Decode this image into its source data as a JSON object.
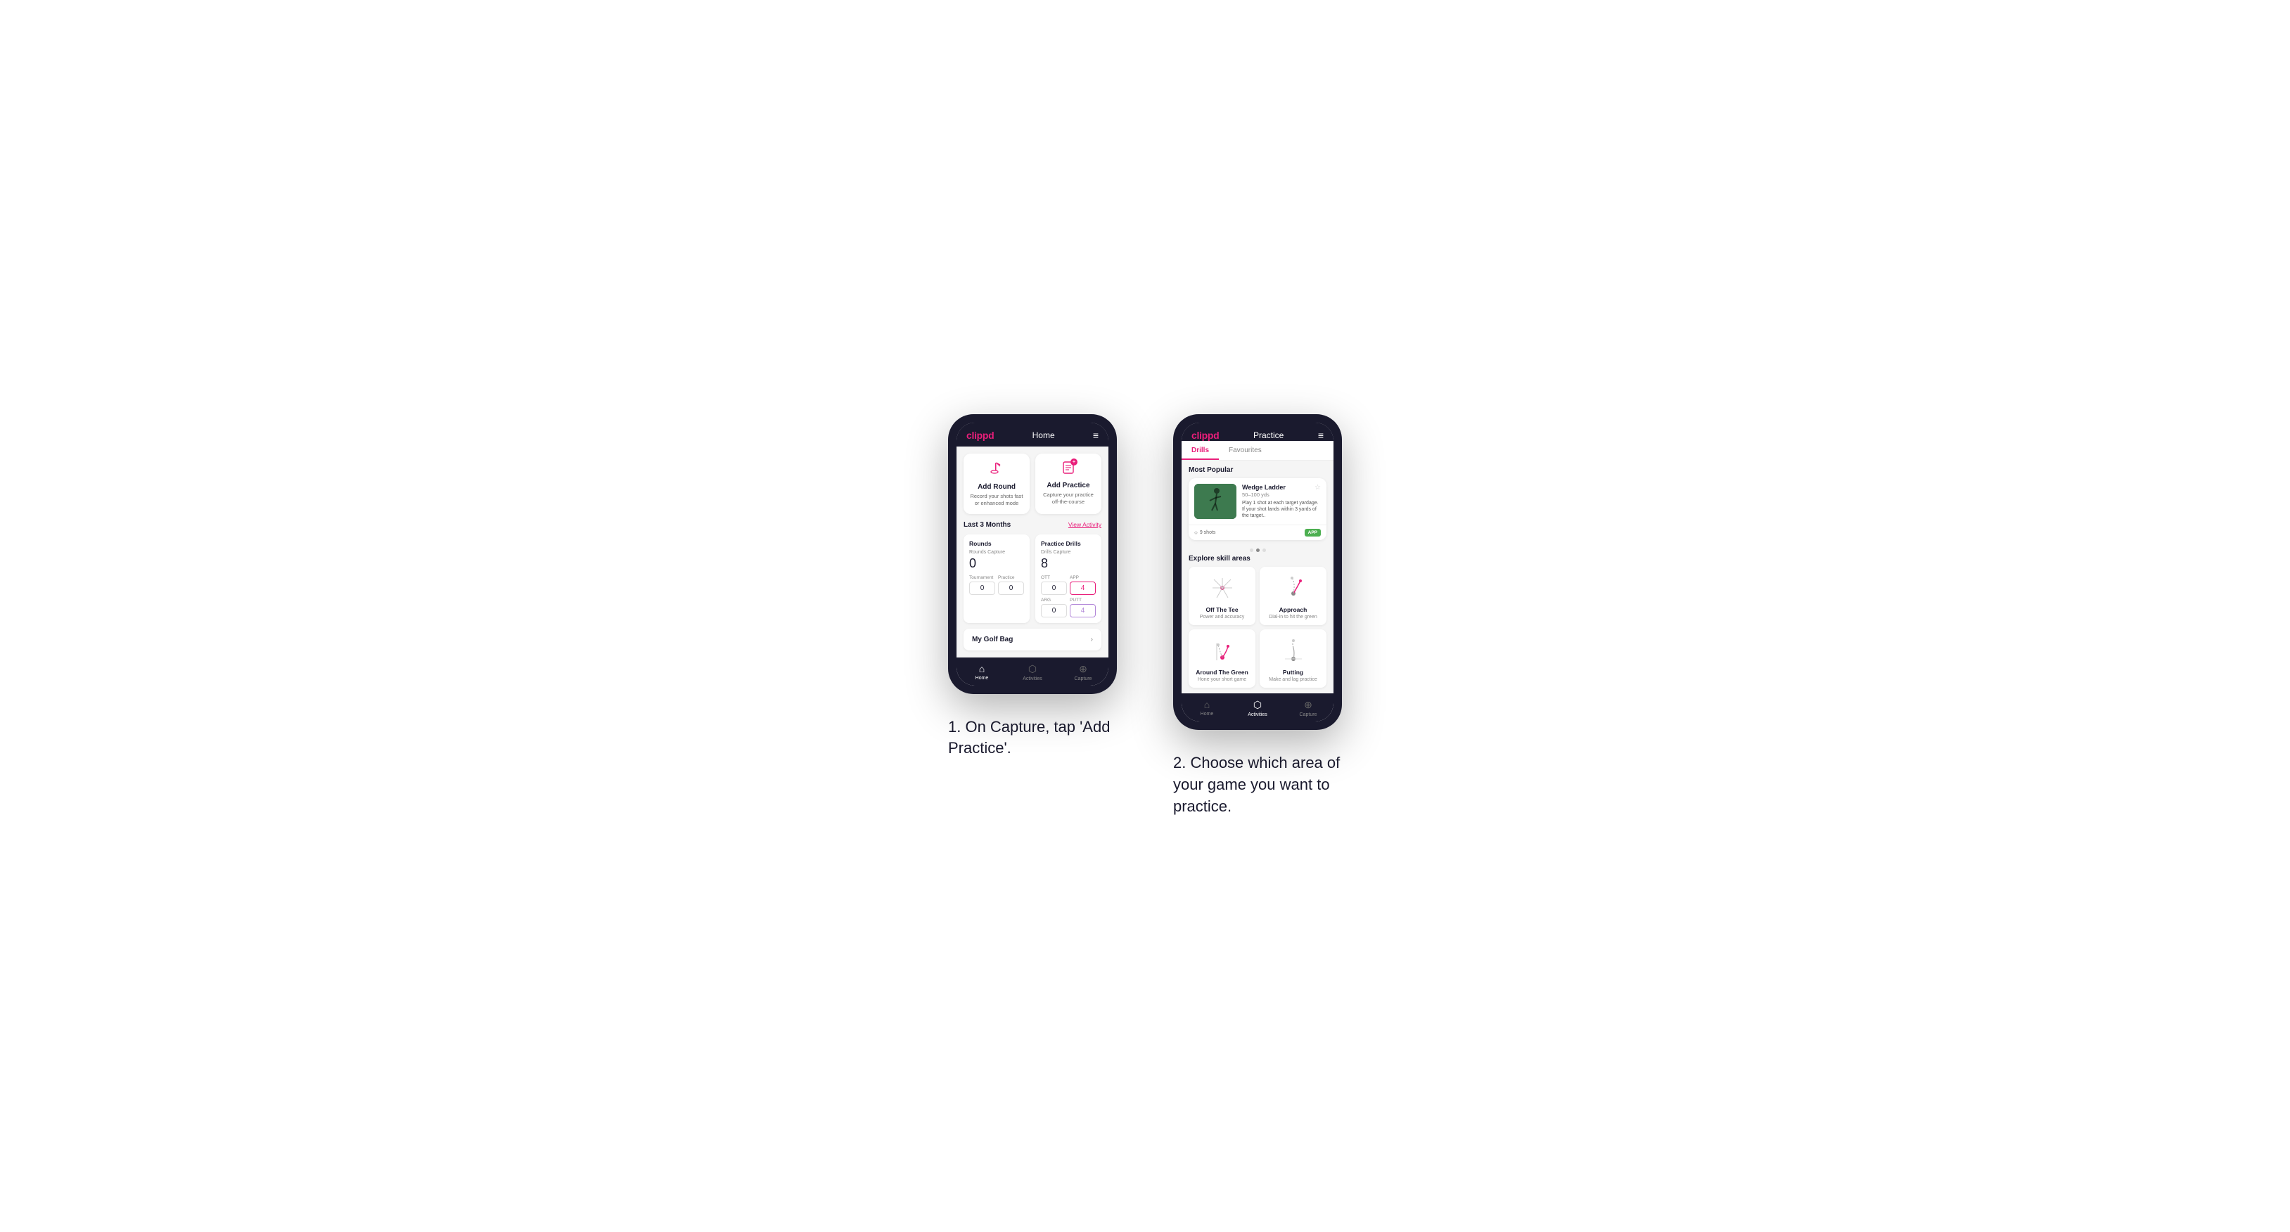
{
  "page": {
    "background": "#ffffff"
  },
  "phone1": {
    "header": {
      "logo": "clippd",
      "title": "Home",
      "menu_icon": "≡"
    },
    "add_round": {
      "title": "Add Round",
      "description": "Record your shots fast or enhanced mode"
    },
    "add_practice": {
      "title": "Add Practice",
      "description": "Capture your practice off-the-course"
    },
    "last_months": {
      "label": "Last 3 Months",
      "view_activity": "View Activity"
    },
    "rounds": {
      "title": "Rounds",
      "rounds_capture_label": "Rounds Capture",
      "rounds_capture_value": "0",
      "tournament_label": "Tournament",
      "tournament_value": "0",
      "practice_label": "Practice",
      "practice_value": "0"
    },
    "practice_drills": {
      "title": "Practice Drills",
      "drills_capture_label": "Drills Capture",
      "drills_capture_value": "8",
      "ott_label": "OTT",
      "ott_value": "0",
      "app_label": "APP",
      "app_value": "4",
      "arg_label": "ARG",
      "arg_value": "0",
      "putt_label": "PUTT",
      "putt_value": "4"
    },
    "my_golf_bag": {
      "label": "My Golf Bag"
    },
    "nav": {
      "home": "Home",
      "activities": "Activities",
      "capture": "Capture"
    }
  },
  "phone2": {
    "header": {
      "logo": "clippd",
      "title": "Practice",
      "menu_icon": "≡"
    },
    "tabs": {
      "drills": "Drills",
      "favourites": "Favourites"
    },
    "most_popular": {
      "label": "Most Popular",
      "drill_name": "Wedge Ladder",
      "drill_yardage": "50–100 yds",
      "drill_description": "Play 1 shot at each target yardage. If your shot lands within 3 yards of the target..",
      "shots_count": "9 shots",
      "badge": "APP"
    },
    "explore": {
      "label": "Explore skill areas",
      "skills": [
        {
          "name": "Off The Tee",
          "description": "Power and accuracy",
          "icon": "tee"
        },
        {
          "name": "Approach",
          "description": "Dial-in to hit the green",
          "icon": "approach"
        },
        {
          "name": "Around The Green",
          "description": "Hone your short game",
          "icon": "around_green"
        },
        {
          "name": "Putting",
          "description": "Make and lag practice",
          "icon": "putting"
        }
      ]
    },
    "nav": {
      "home": "Home",
      "activities": "Activities",
      "capture": "Capture"
    }
  },
  "captions": {
    "phone1": "1. On Capture, tap 'Add Practice'.",
    "phone2": "2. Choose which area of your game you want to practice."
  }
}
